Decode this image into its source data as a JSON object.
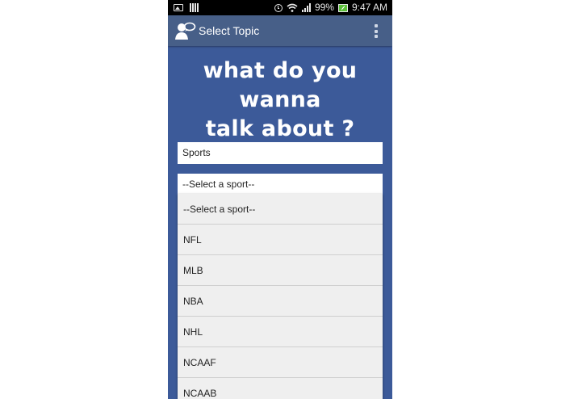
{
  "status_bar": {
    "battery_percent": "99%",
    "time": "9:47 AM",
    "icons": [
      "image-icon",
      "barcode-icon",
      "alarm-icon",
      "wifi-icon",
      "signal-icon",
      "battery-charging-icon"
    ]
  },
  "action_bar": {
    "title": "Select Topic",
    "logo_icon": "chat-person-icon",
    "menu_icon": "overflow-menu-icon"
  },
  "heading": {
    "line1": "what do you wanna",
    "line2": "talk about ?"
  },
  "topic_field": {
    "value": "Sports"
  },
  "sport_select": {
    "selected": "--Select a sport--",
    "options": [
      "--Select a sport--",
      "NFL",
      "MLB",
      "NBA",
      "NHL",
      "NCAAF",
      "NCAAB"
    ]
  }
}
